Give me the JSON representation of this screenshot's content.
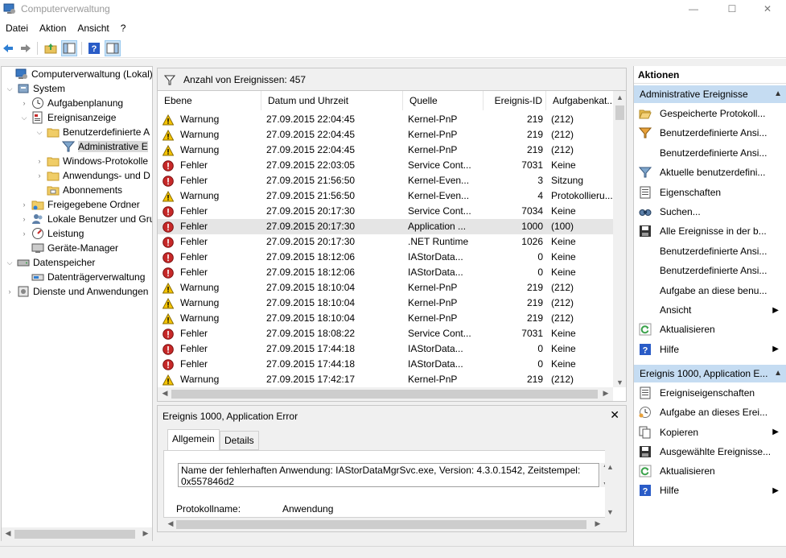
{
  "window": {
    "title": "Computerverwaltung",
    "minimize_glyph": "—",
    "maximize_glyph": "☐",
    "close_glyph": "✕"
  },
  "menu": [
    "Datei",
    "Aktion",
    "Ansicht",
    "?"
  ],
  "tree": {
    "items": [
      {
        "label": "Computerverwaltung (Lokal)",
        "icon": "computer-management-icon"
      },
      {
        "label": "System",
        "icon": "system-tools-icon"
      },
      {
        "label": "Aufgabenplanung",
        "icon": "task-scheduler-icon"
      },
      {
        "label": "Ereignisanzeige",
        "icon": "event-viewer-icon"
      },
      {
        "label": "Benutzerdefinierte A",
        "icon": "folder-icon"
      },
      {
        "label": "Administrative E",
        "icon": "filter-icon"
      },
      {
        "label": "Windows-Protokolle",
        "icon": "folder-icon"
      },
      {
        "label": "Anwendungs- und D",
        "icon": "folder-icon"
      },
      {
        "label": "Abonnements",
        "icon": "subscriptions-icon"
      },
      {
        "label": "Freigegebene Ordner",
        "icon": "shared-folder-icon"
      },
      {
        "label": "Lokale Benutzer und Gru",
        "icon": "users-icon"
      },
      {
        "label": "Leistung",
        "icon": "performance-icon"
      },
      {
        "label": "Geräte-Manager",
        "icon": "device-manager-icon"
      },
      {
        "label": "Datenspeicher",
        "icon": "storage-icon"
      },
      {
        "label": "Datenträgerverwaltung",
        "icon": "disk-management-icon"
      },
      {
        "label": "Dienste und Anwendungen",
        "icon": "services-icon"
      }
    ]
  },
  "events": {
    "count_label": "Anzahl von Ereignissen: 457",
    "columns": [
      "Ebene",
      "Datum und Uhrzeit",
      "Quelle",
      "Ereignis-ID",
      "Aufgabenkat..."
    ],
    "rows": [
      {
        "level": "Warnung",
        "level_kind": "warning",
        "date": "27.09.2015 22:04:45",
        "source": "Kernel-PnP",
        "id": "219",
        "task": "(212)"
      },
      {
        "level": "Warnung",
        "level_kind": "warning",
        "date": "27.09.2015 22:04:45",
        "source": "Kernel-PnP",
        "id": "219",
        "task": "(212)"
      },
      {
        "level": "Warnung",
        "level_kind": "warning",
        "date": "27.09.2015 22:04:45",
        "source": "Kernel-PnP",
        "id": "219",
        "task": "(212)"
      },
      {
        "level": "Fehler",
        "level_kind": "error",
        "date": "27.09.2015 22:03:05",
        "source": "Service Cont...",
        "id": "7031",
        "task": "Keine"
      },
      {
        "level": "Fehler",
        "level_kind": "error",
        "date": "27.09.2015 21:56:50",
        "source": "Kernel-Even...",
        "id": "3",
        "task": "Sitzung"
      },
      {
        "level": "Warnung",
        "level_kind": "warning",
        "date": "27.09.2015 21:56:50",
        "source": "Kernel-Even...",
        "id": "4",
        "task": "Protokollieru..."
      },
      {
        "level": "Fehler",
        "level_kind": "error",
        "date": "27.09.2015 20:17:30",
        "source": "Service Cont...",
        "id": "7034",
        "task": "Keine"
      },
      {
        "level": "Fehler",
        "level_kind": "error",
        "date": "27.09.2015 20:17:30",
        "source": "Application ...",
        "id": "1000",
        "task": "(100)"
      },
      {
        "level": "Fehler",
        "level_kind": "error",
        "date": "27.09.2015 20:17:30",
        "source": ".NET Runtime",
        "id": "1026",
        "task": "Keine"
      },
      {
        "level": "Fehler",
        "level_kind": "error",
        "date": "27.09.2015 18:12:06",
        "source": "IAStorData...",
        "id": "0",
        "task": "Keine"
      },
      {
        "level": "Fehler",
        "level_kind": "error",
        "date": "27.09.2015 18:12:06",
        "source": "IAStorData...",
        "id": "0",
        "task": "Keine"
      },
      {
        "level": "Warnung",
        "level_kind": "warning",
        "date": "27.09.2015 18:10:04",
        "source": "Kernel-PnP",
        "id": "219",
        "task": "(212)"
      },
      {
        "level": "Warnung",
        "level_kind": "warning",
        "date": "27.09.2015 18:10:04",
        "source": "Kernel-PnP",
        "id": "219",
        "task": "(212)"
      },
      {
        "level": "Warnung",
        "level_kind": "warning",
        "date": "27.09.2015 18:10:04",
        "source": "Kernel-PnP",
        "id": "219",
        "task": "(212)"
      },
      {
        "level": "Fehler",
        "level_kind": "error",
        "date": "27.09.2015 18:08:22",
        "source": "Service Cont...",
        "id": "7031",
        "task": "Keine"
      },
      {
        "level": "Fehler",
        "level_kind": "error",
        "date": "27.09.2015 17:44:18",
        "source": "IAStorData...",
        "id": "0",
        "task": "Keine"
      },
      {
        "level": "Fehler",
        "level_kind": "error",
        "date": "27.09.2015 17:44:18",
        "source": "IAStorData...",
        "id": "0",
        "task": "Keine"
      },
      {
        "level": "Warnung",
        "level_kind": "warning",
        "date": "27.09.2015 17:42:17",
        "source": "Kernel-PnP",
        "id": "219",
        "task": "(212)"
      }
    ]
  },
  "detail": {
    "title": "Ereignis 1000, Application Error",
    "close_glyph": "✕",
    "tabs": [
      "Allgemein",
      "Details"
    ],
    "message": "Name der fehlerhaften Anwendung: IAStorDataMgrSvc.exe, Version: 4.3.0.1542, Zeitstempel: 0x557846d2",
    "protocol_label": "Protokollname:",
    "protocol_value": "Anwendung"
  },
  "actions": {
    "header": "Aktionen",
    "sections": [
      {
        "title": "Administrative Ereignisse",
        "items": [
          {
            "label": "Gespeicherte Protokoll...",
            "icon": "open-folder-icon"
          },
          {
            "label": "Benutzerdefinierte Ansi...",
            "icon": "create-filter-icon"
          },
          {
            "label": "Benutzerdefinierte Ansi...",
            "icon": ""
          },
          {
            "label": "Aktuelle benutzerdefini...",
            "icon": "filter-icon"
          },
          {
            "label": "Eigenschaften",
            "icon": "properties-icon"
          },
          {
            "label": "Suchen...",
            "icon": "find-icon"
          },
          {
            "label": "Alle Ereignisse in der b...",
            "icon": "save-icon"
          },
          {
            "label": "Benutzerdefinierte Ansi...",
            "icon": ""
          },
          {
            "label": "Benutzerdefinierte Ansi...",
            "icon": ""
          },
          {
            "label": "Aufgabe an diese benu...",
            "icon": ""
          },
          {
            "label": "Ansicht",
            "icon": "",
            "submenu": true
          },
          {
            "label": "Aktualisieren",
            "icon": "refresh-icon"
          },
          {
            "label": "Hilfe",
            "icon": "help-icon",
            "submenu": true
          }
        ]
      },
      {
        "title": "Ereignis 1000, Application E...",
        "items": [
          {
            "label": "Ereigniseigenschaften",
            "icon": "properties-icon"
          },
          {
            "label": "Aufgabe an dieses Erei...",
            "icon": "attach-task-icon"
          },
          {
            "label": "Kopieren",
            "icon": "copy-icon",
            "submenu": true
          },
          {
            "label": "Ausgewählte Ereignisse...",
            "icon": "save-icon"
          },
          {
            "label": "Aktualisieren",
            "icon": "refresh-icon"
          },
          {
            "label": "Hilfe",
            "icon": "help-icon",
            "submenu": true
          }
        ]
      }
    ],
    "submenu_glyph": "▶",
    "collapse_glyph": "▲"
  },
  "colors": {
    "selection": "#d9d9d9",
    "section_header": "#c5dcf2",
    "warning": "#f5c400",
    "error": "#c62828"
  }
}
